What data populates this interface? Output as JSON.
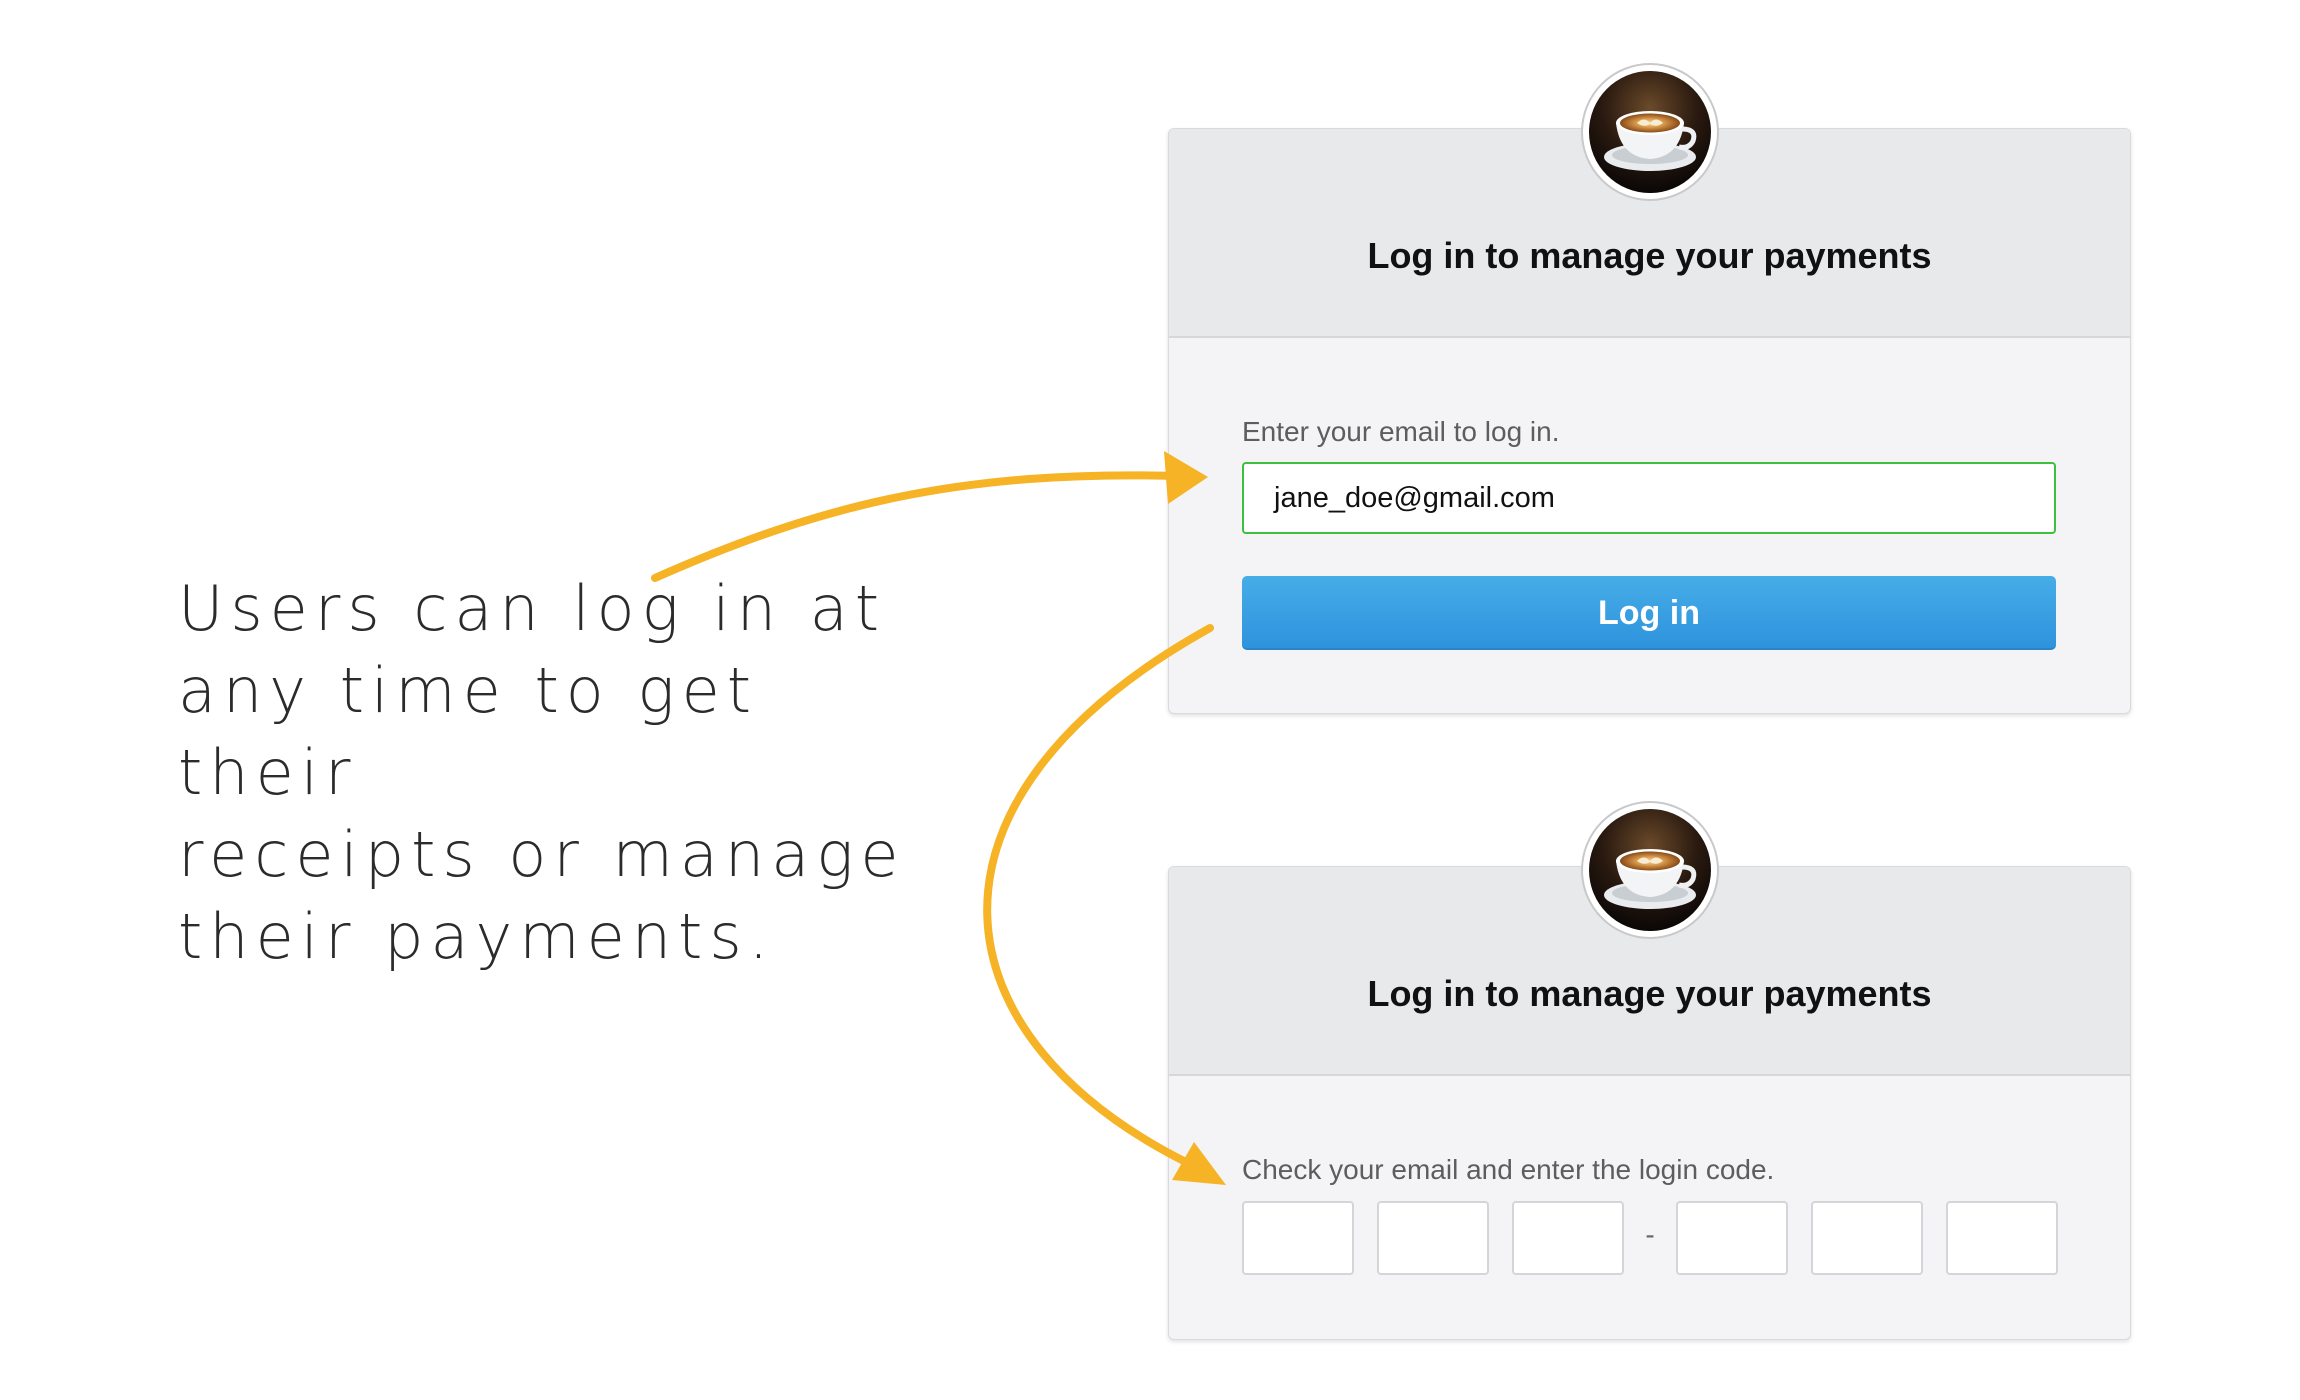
{
  "caption": {
    "lines": [
      "Users can log in at",
      "any time to get their",
      "receipts or manage",
      "their payments."
    ]
  },
  "login_card": {
    "title": "Log in to manage your payments",
    "avatar_icon": "coffee-cup-icon",
    "email_label": "Enter your email to log in.",
    "email_value": "jane_doe@gmail.com",
    "button_label": "Log in"
  },
  "code_card": {
    "title": "Log in to manage your payments",
    "avatar_icon": "coffee-cup-icon",
    "instruction": "Check your email and enter the login code.",
    "separator": "-",
    "code_digits": [
      "",
      "",
      "",
      "",
      "",
      ""
    ]
  },
  "colors": {
    "arrow": "#f5b325",
    "button": "#3aa2e4",
    "input_focus_border": "#3fbf3f",
    "card_header": "#e8e9eb",
    "card_body": "#f4f4f6"
  }
}
